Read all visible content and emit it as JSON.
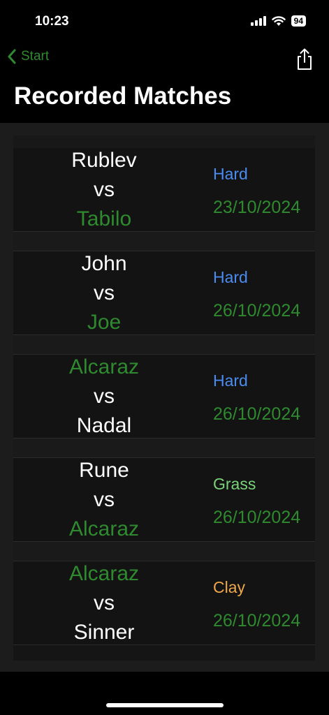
{
  "status": {
    "time": "10:23",
    "battery": "94"
  },
  "nav": {
    "back_label": "Start",
    "title": "Recorded Matches"
  },
  "colors": {
    "green": "#2f8a2f",
    "hard": "#4a8cf0",
    "grass": "#7ad37a",
    "clay": "#f0a64a"
  },
  "matches": [
    {
      "player1": "Rublev",
      "vs": "vs",
      "player2": "Tabilo",
      "surface": "Hard",
      "date": "23/10/2024"
    },
    {
      "player1": "John",
      "vs": "vs",
      "player2": "Joe",
      "surface": "Hard",
      "date": "26/10/2024"
    },
    {
      "player1": "Alcaraz",
      "vs": "vs",
      "player2": "Nadal",
      "surface": "Hard",
      "date": "26/10/2024"
    },
    {
      "player1": "Rune",
      "vs": "vs",
      "player2": "Alcaraz",
      "surface": "Grass",
      "date": "26/10/2024"
    },
    {
      "player1": "Alcaraz",
      "vs": "vs",
      "player2": "Sinner",
      "surface": "Clay",
      "date": "26/10/2024"
    }
  ]
}
